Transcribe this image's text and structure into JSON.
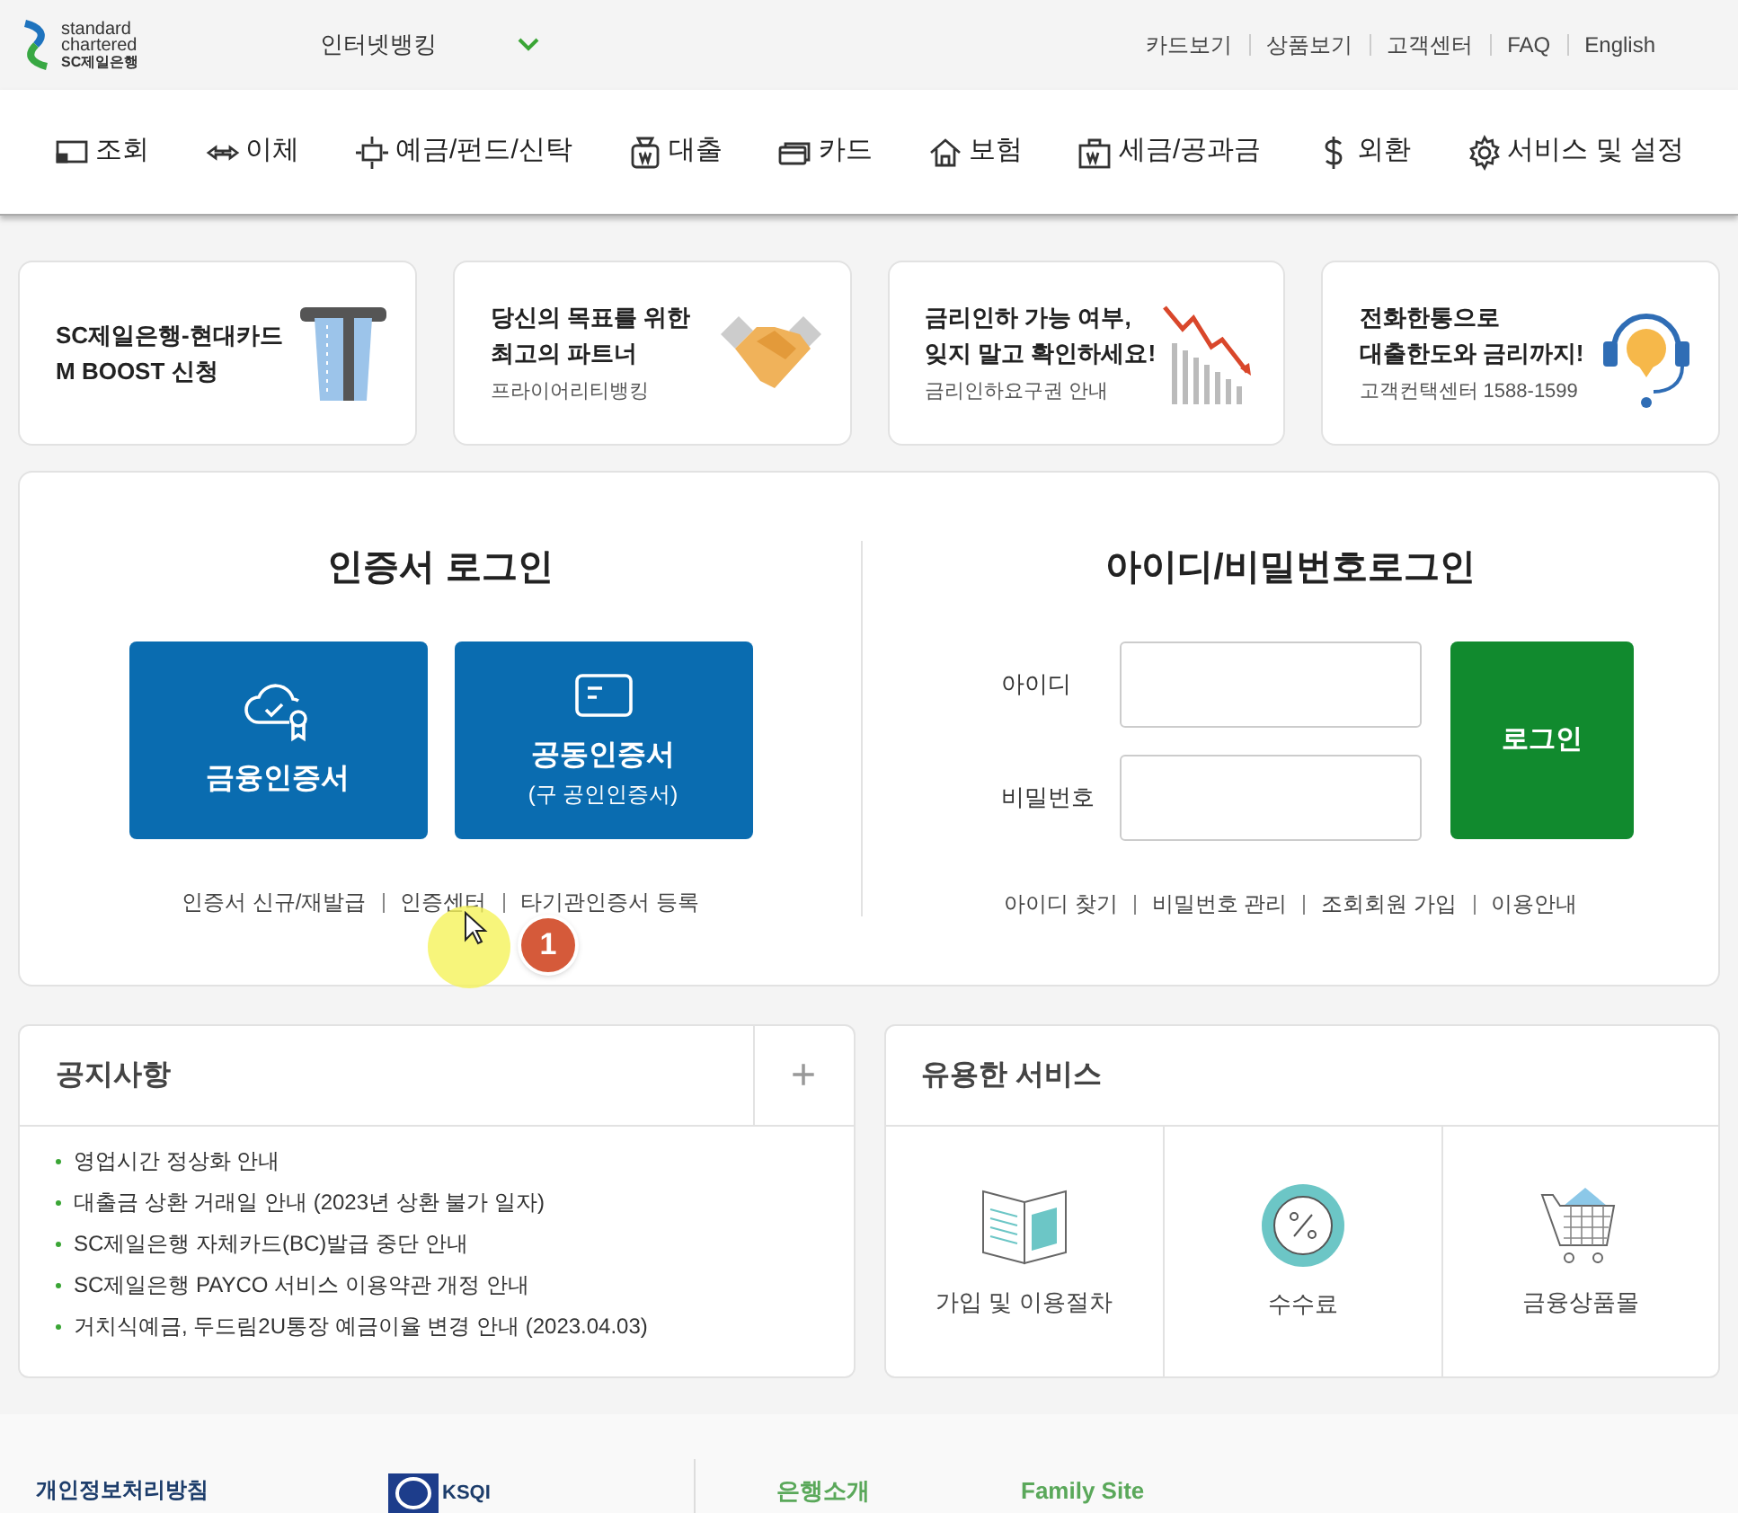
{
  "header": {
    "logo_lines": [
      "standard",
      "chartered",
      "SC제일은행"
    ],
    "site_select": "인터넷뱅킹",
    "utility_links": [
      "카드보기",
      "상품보기",
      "고객센터",
      "FAQ",
      "English"
    ]
  },
  "nav": [
    {
      "label": "조회",
      "kind": "monitor"
    },
    {
      "label": "이체",
      "kind": "transfer"
    },
    {
      "label": "예금/펀드/신탁",
      "kind": "deposit"
    },
    {
      "label": "대출",
      "kind": "loan"
    },
    {
      "label": "카드",
      "kind": "card"
    },
    {
      "label": "보험",
      "kind": "house"
    },
    {
      "label": "세금/공과금",
      "kind": "tax"
    },
    {
      "label": "외환",
      "kind": "dollar"
    },
    {
      "label": "서비스 및 설정",
      "kind": "gear"
    }
  ],
  "banners": [
    {
      "title_lines": [
        "SC제일은행-현대카드",
        "M BOOST 신청"
      ],
      "kind": "atm"
    },
    {
      "title_lines": [
        "당신의 목표를 위한",
        "최고의 파트너"
      ],
      "subtitle": "프라이어리티뱅킹",
      "kind": "handshake"
    },
    {
      "title_lines": [
        "금리인하 가능 여부,",
        "잊지 말고 확인하세요!"
      ],
      "subtitle": "금리인하요구권 안내",
      "kind": "chart"
    },
    {
      "title_lines": [
        "전화한통으로",
        "대출한도와 금리까지!"
      ],
      "subtitle": "고객컨택센터 1588-1599",
      "kind": "headset"
    }
  ],
  "cert_login": {
    "title": "인증서 로그인",
    "buttons": [
      {
        "label": "금융인증서",
        "kind": "cloud"
      },
      {
        "label": "공동인증서",
        "sublabel": "(구 공인인증서)",
        "kind": "card"
      }
    ],
    "links": [
      "인증서 신규/재발급",
      "인증센터",
      "타기관인증서 등록"
    ],
    "annotation": "1"
  },
  "id_login": {
    "title": "아이디/비밀번호로그인",
    "fields": [
      {
        "label": "아이디"
      },
      {
        "label": "비밀번호"
      }
    ],
    "login_button": "로그인",
    "links": [
      "아이디 찾기",
      "비밀번호 관리",
      "조회회원 가입",
      "이용안내"
    ]
  },
  "notices": {
    "title": "공지사항",
    "more": "+",
    "items": [
      "영업시간 정상화 안내",
      "대출금 상환 거래일 안내 (2023년 상환 불가 일자)",
      "SC제일은행 자체카드(BC)발급 중단 안내",
      "SC제일은행 PAYCO 서비스 이용약관 개정 안내",
      "거치식예금, 두드림2U통장 예금이율 변경 안내 (2023.04.03)"
    ]
  },
  "services": {
    "title": "유용한 서비스",
    "items": [
      {
        "label": "가입 및 이용절차",
        "kind": "book"
      },
      {
        "label": "수수료",
        "kind": "percent"
      },
      {
        "label": "금융상품몰",
        "kind": "cart"
      }
    ]
  },
  "footer": {
    "privacy": "개인정보처리방침",
    "ksqi": "KSQI",
    "links": [
      "은행소개",
      "Family Site"
    ]
  }
}
